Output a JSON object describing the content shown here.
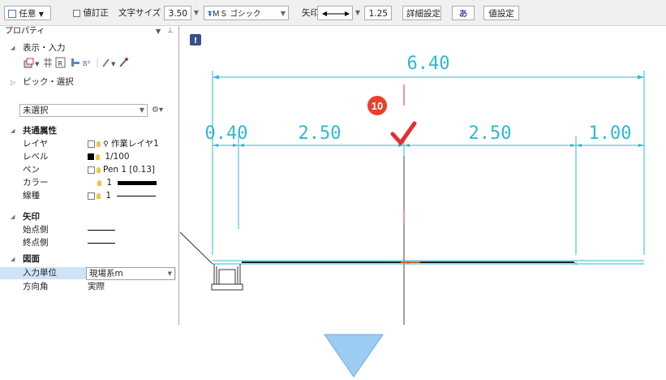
{
  "toolbar": {
    "mode_label": "任意",
    "correction_label": "値訂正",
    "text_size_label": "文字サイズ",
    "text_size_value": "3.50",
    "font_name": "ＭＳ ゴシック",
    "arrow_label": "矢印",
    "arrow_size_value": "1.25",
    "detail_button": "詳細設定",
    "value_settings_button": "値設定",
    "text_icon": "あ"
  },
  "panel": {
    "title": "プロパティ",
    "pin_icon": "pin-icon",
    "display_input_label": "表示・入力",
    "pick_select_label": "ピック・選択",
    "selection_value": "未選択",
    "common_header": "共通属性",
    "common": {
      "layer_key": "レイヤ",
      "layer_val": "作業レイヤ1",
      "level_key": "レベル",
      "level_val": "1/100",
      "pen_key": "ペン",
      "pen_val": "Pen 1 [0.13]",
      "color_key": "カラー",
      "color_val": "1",
      "linetype_key": "線種",
      "linetype_val": "1"
    },
    "arrow_header": "矢印",
    "arrow": {
      "start_key": "始点側",
      "end_key": "終点側"
    },
    "drawing_header": "図面",
    "drawing": {
      "unit_key": "入力単位",
      "unit_val": "現場系m",
      "direction_key": "方向角",
      "direction_val": "実際"
    }
  },
  "canvas": {
    "info_badge": "!",
    "step_badge": "10",
    "dim_total": "6.40",
    "dim_1": "0.40",
    "dim_2": "2.50",
    "dim_3": "2.50",
    "dim_4": "1.00"
  },
  "colors": {
    "dimension": "#2fb7d9",
    "step_badge": "#e8402a",
    "check": "#e03030",
    "down_arrow": "#9cccf2"
  }
}
